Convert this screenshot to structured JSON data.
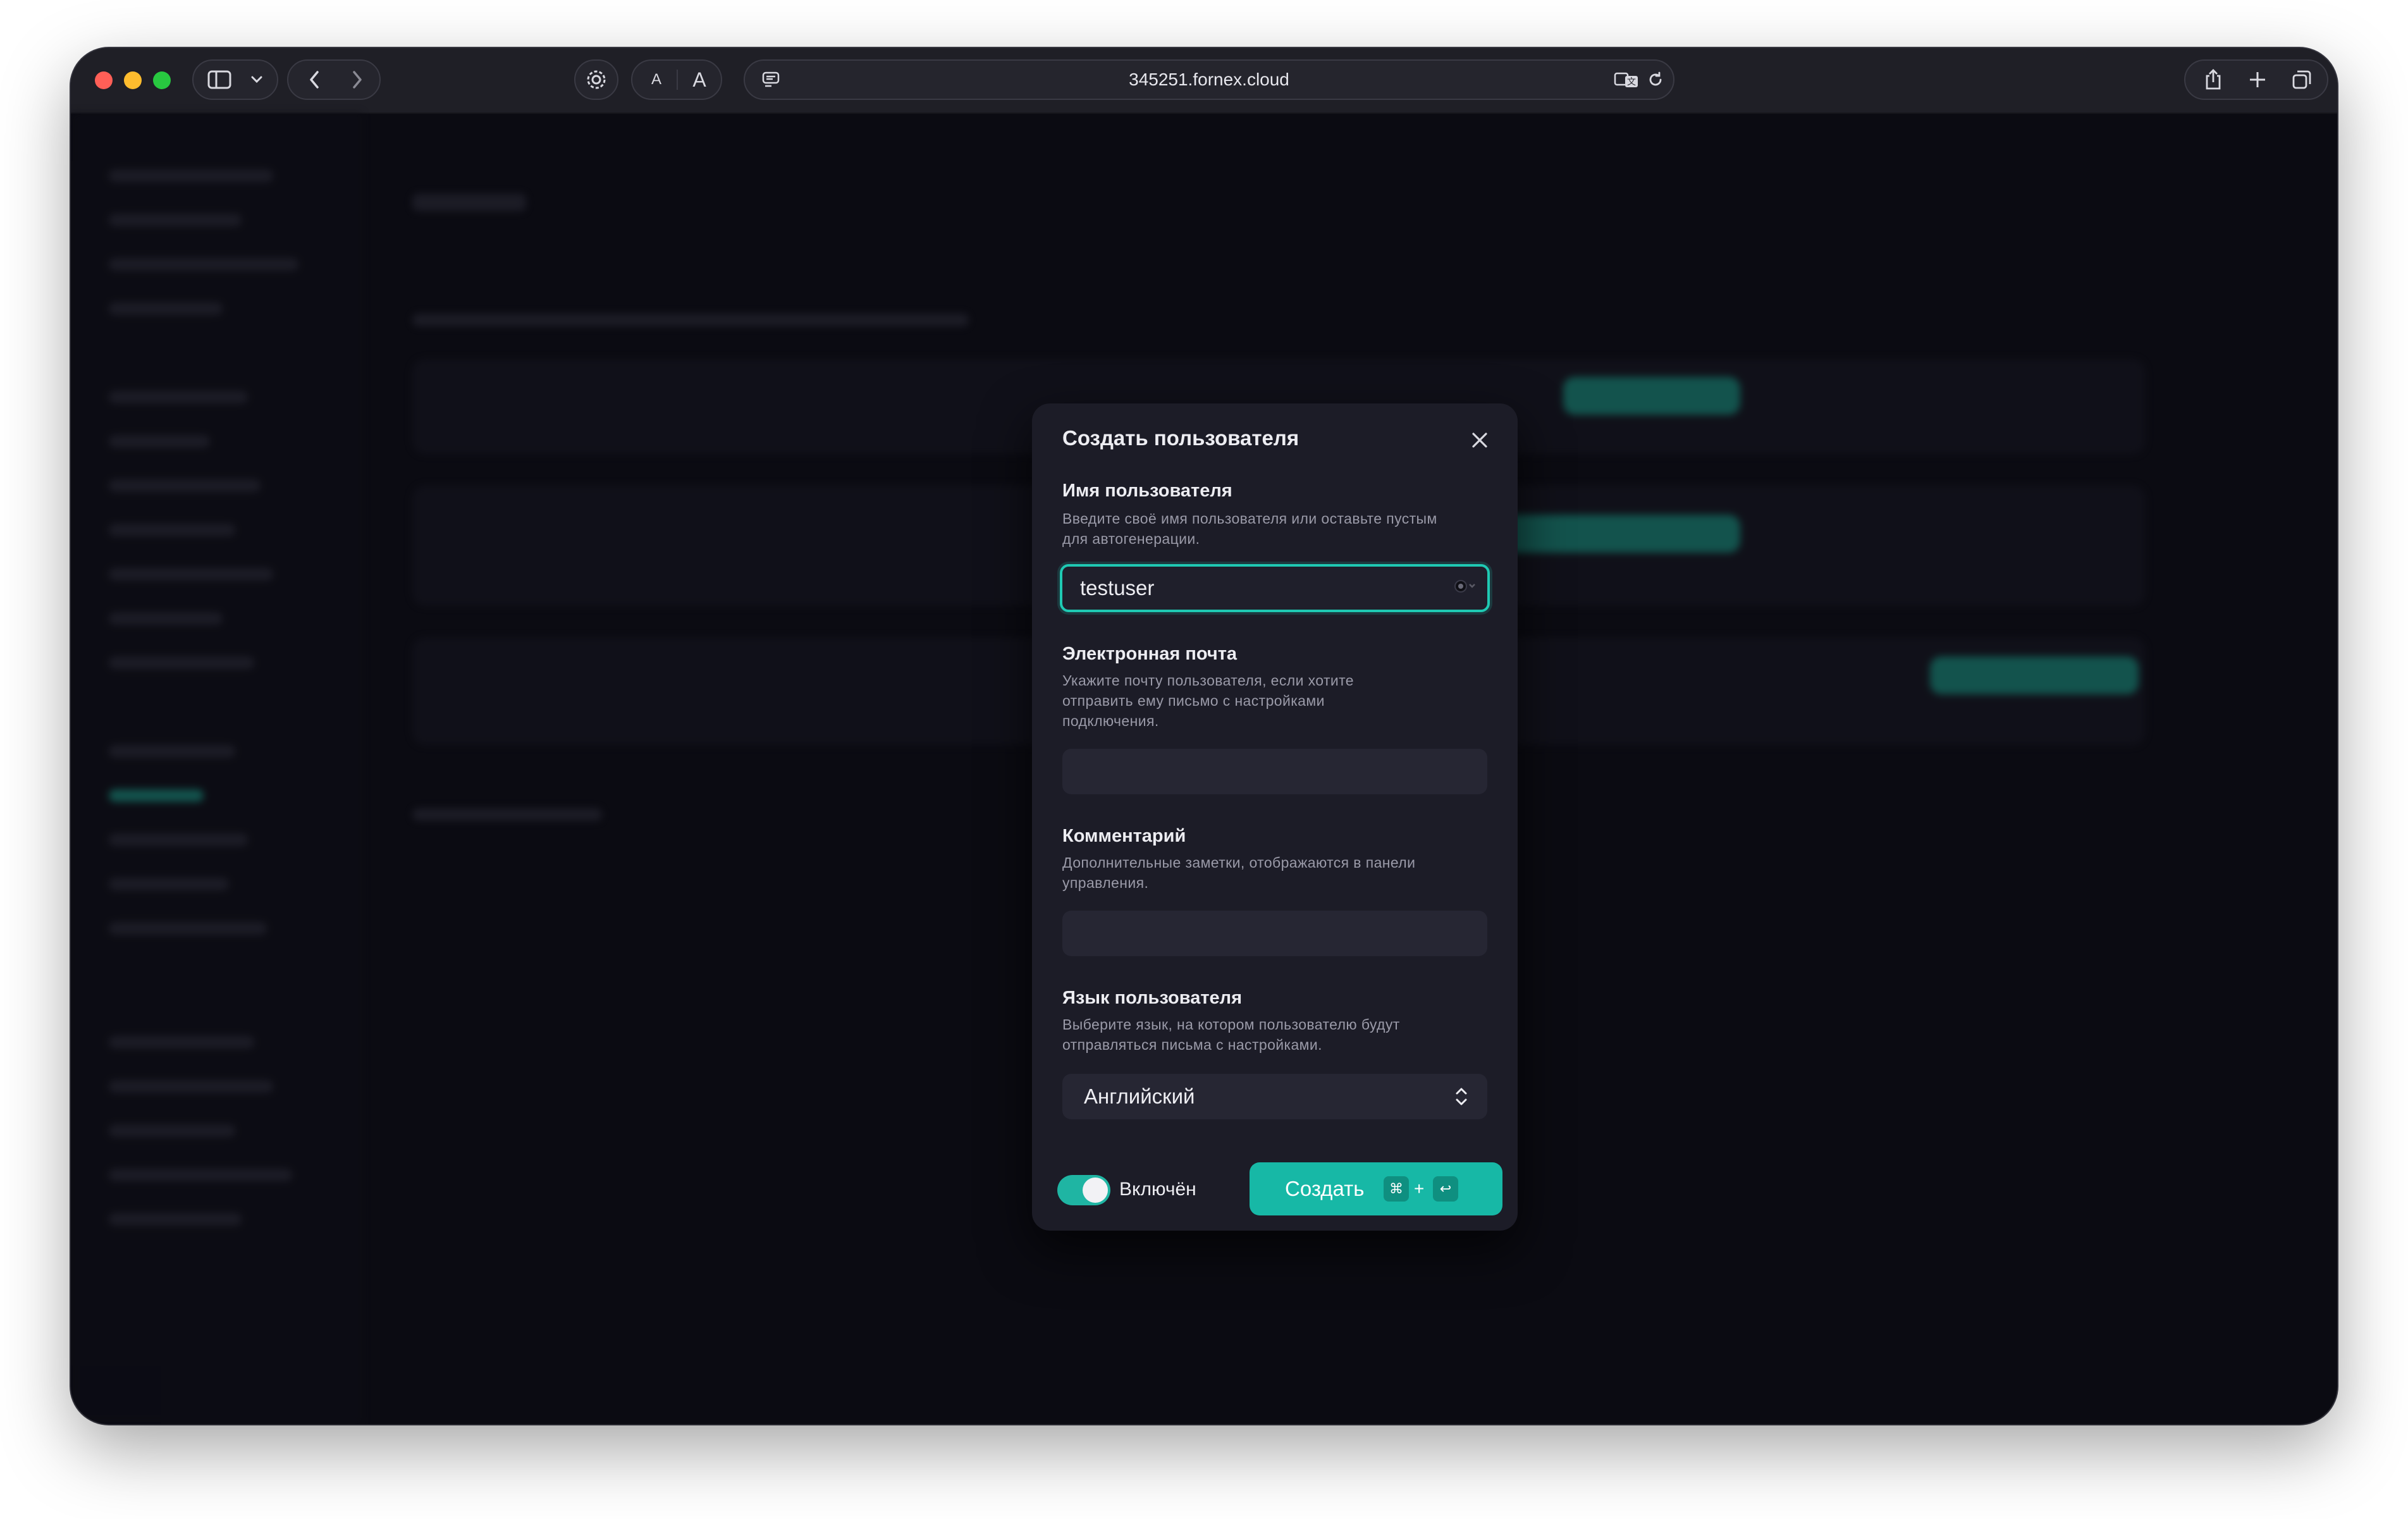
{
  "browser": {
    "url": "345251.fornex.cloud",
    "font_small_label": "A",
    "font_large_label": "A"
  },
  "modal": {
    "title": "Создать пользователя",
    "username": {
      "label": "Имя пользователя",
      "hint": "Введите своё имя пользователя или оставьте пустым для автогенерации.",
      "value": "testuser"
    },
    "email": {
      "label": "Электронная почта",
      "hint": "Укажите почту пользователя, если хотите отправить ему письмо с настройками подключения.",
      "value": ""
    },
    "comment": {
      "label": "Комментарий",
      "hint": "Дополнительные заметки, отображаются в панели управления.",
      "value": ""
    },
    "language": {
      "label": "Язык пользователя",
      "hint": "Выберите язык, на котором пользователю будут отправляться письма с настройками.",
      "selected": "Английский"
    },
    "enabled": {
      "label": "Включён",
      "on": true
    },
    "create_button": {
      "label": "Создать",
      "shortcut_mod": "⌘",
      "shortcut_plus": "+",
      "shortcut_key": "↩"
    }
  },
  "colors": {
    "accent": "#17b8a6",
    "modal_bg": "#1c1c27",
    "input_bg": "#262633",
    "page_bg": "#0b0b12"
  }
}
